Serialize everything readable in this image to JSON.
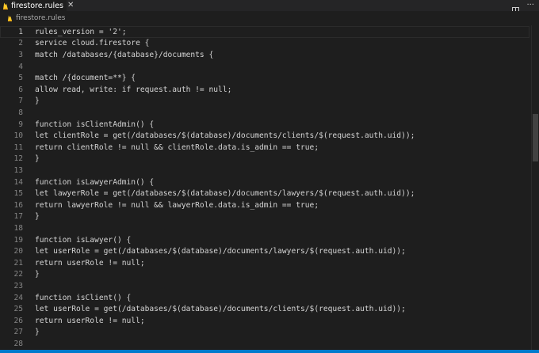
{
  "tab": {
    "label": "firestore.rules",
    "close_glyph": "✕",
    "icon": "flame-icon"
  },
  "actions": {
    "split_icon": "split-editor-icon",
    "more_glyph": "···"
  },
  "breadcrumb": {
    "label": "firestore.rules",
    "icon": "flame-icon"
  },
  "editor": {
    "current_line": 1,
    "lines": [
      {
        "num": "1",
        "text": "rules_version = '2';"
      },
      {
        "num": "2",
        "text": "service cloud.firestore {"
      },
      {
        "num": "3",
        "text": "match /databases/{database}/documents {"
      },
      {
        "num": "4",
        "text": ""
      },
      {
        "num": "5",
        "text": "match /{document=**} {"
      },
      {
        "num": "6",
        "text": "allow read, write: if request.auth != null;"
      },
      {
        "num": "7",
        "text": "}"
      },
      {
        "num": "8",
        "text": ""
      },
      {
        "num": "9",
        "text": "function isClientAdmin() {"
      },
      {
        "num": "10",
        "text": "let clientRole = get(/databases/$(database)/documents/clients/$(request.auth.uid));"
      },
      {
        "num": "11",
        "text": "return clientRole != null && clientRole.data.is_admin == true;"
      },
      {
        "num": "12",
        "text": "}"
      },
      {
        "num": "13",
        "text": ""
      },
      {
        "num": "14",
        "text": "function isLawyerAdmin() {"
      },
      {
        "num": "15",
        "text": "let lawyerRole = get(/databases/$(database)/documents/lawyers/$(request.auth.uid));"
      },
      {
        "num": "16",
        "text": "return lawyerRole != null && lawyerRole.data.is_admin == true;"
      },
      {
        "num": "17",
        "text": "}"
      },
      {
        "num": "18",
        "text": ""
      },
      {
        "num": "19",
        "text": "function isLawyer() {"
      },
      {
        "num": "20",
        "text": "let userRole = get(/databases/$(database)/documents/lawyers/$(request.auth.uid));"
      },
      {
        "num": "21",
        "text": "return userRole != null;"
      },
      {
        "num": "22",
        "text": "}"
      },
      {
        "num": "23",
        "text": ""
      },
      {
        "num": "24",
        "text": "function isClient() {"
      },
      {
        "num": "25",
        "text": "let userRole = get(/databases/$(database)/documents/clients/$(request.auth.uid));"
      },
      {
        "num": "26",
        "text": "return userRole != null;"
      },
      {
        "num": "27",
        "text": "}"
      },
      {
        "num": "28",
        "text": ""
      }
    ]
  },
  "colors": {
    "editor_bg": "#1e1e1e",
    "tabbar_bg": "#252526",
    "status_bar": "#007acc",
    "flame_icon": "#ffa000"
  }
}
